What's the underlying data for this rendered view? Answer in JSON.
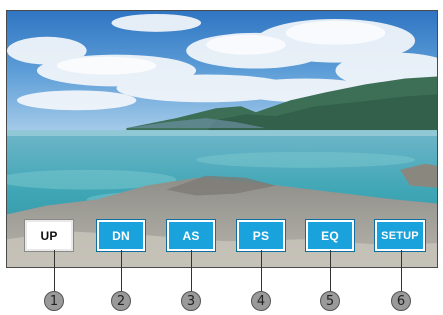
{
  "buttons": [
    {
      "label": "UP",
      "active": true
    },
    {
      "label": "DN",
      "active": false
    },
    {
      "label": "AS",
      "active": false
    },
    {
      "label": "PS",
      "active": false
    },
    {
      "label": "EQ",
      "active": false
    },
    {
      "label": "SETUP",
      "active": false
    }
  ],
  "callouts": [
    "1",
    "2",
    "3",
    "4",
    "5",
    "6"
  ],
  "colors": {
    "button_bg": "#1aa2dc",
    "button_active_bg": "#ffffff",
    "callout_bg": "#9a9a9a"
  }
}
